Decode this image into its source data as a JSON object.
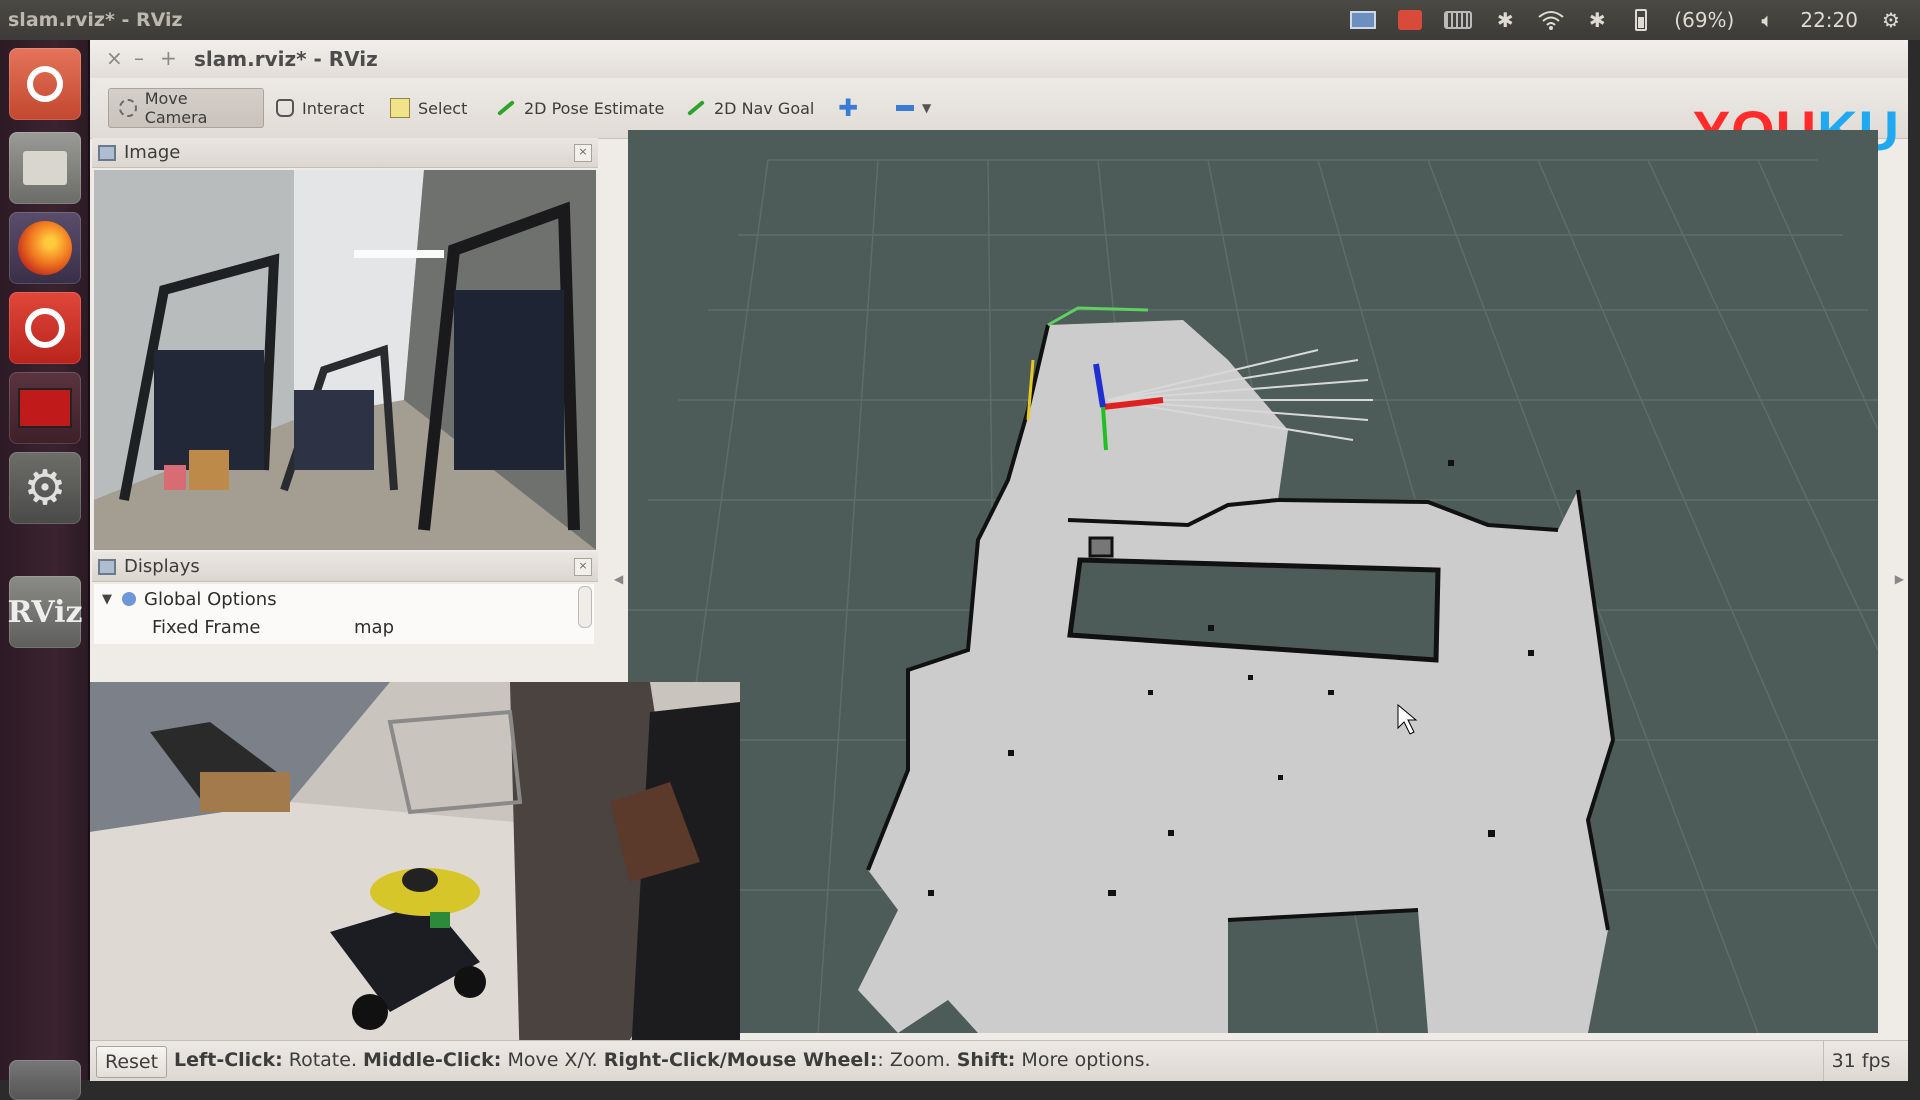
{
  "panel": {
    "window_title": "slam.rviz* - RViz",
    "tray": {
      "battery": "(69%)",
      "time": "22:20"
    }
  },
  "launcher": {
    "items": [
      "ubuntu",
      "files",
      "firefox",
      "music",
      "screen-recorder",
      "settings",
      "rviz",
      "trash"
    ],
    "rviz_label": "RViz"
  },
  "window": {
    "title": "slam.rviz* - RViz",
    "controls": [
      "×",
      "–",
      "+"
    ]
  },
  "toolbar": {
    "tools": [
      {
        "label": "Move Camera",
        "icon": "move-camera-icon",
        "active": true
      },
      {
        "label": "Interact",
        "icon": "hand-icon"
      },
      {
        "label": "Select",
        "icon": "select-icon"
      },
      {
        "label": "2D Pose Estimate",
        "icon": "green-arrow-icon"
      },
      {
        "label": "2D Nav Goal",
        "icon": "green-arrow-icon"
      }
    ],
    "add_symbol": "✚",
    "watermark": {
      "red": "YOU",
      "blue": "KU"
    }
  },
  "image_panel": {
    "title": "Image"
  },
  "displays_panel": {
    "title": "Displays",
    "global_options": "Global Options",
    "fixed_frame_label": "Fixed Frame",
    "fixed_frame_value": "map"
  },
  "statusbar": {
    "reset": "Reset",
    "hint": [
      {
        "bold": "Left-Click:",
        "text": " Rotate. "
      },
      {
        "bold": "Middle-Click:",
        "text": " Move X/Y. "
      },
      {
        "bold": "Right-Click/Mouse Wheel:",
        "text": ": Zoom. "
      },
      {
        "bold": "Shift:",
        "text": " More options."
      }
    ],
    "fps": "31 fps"
  },
  "colors": {
    "viewport_bg": "#4d5b59",
    "map_free": "#cccccc",
    "map_wall": "#111111",
    "axis_x": "#e02020",
    "axis_y": "#20c020",
    "axis_z": "#2030d0"
  }
}
